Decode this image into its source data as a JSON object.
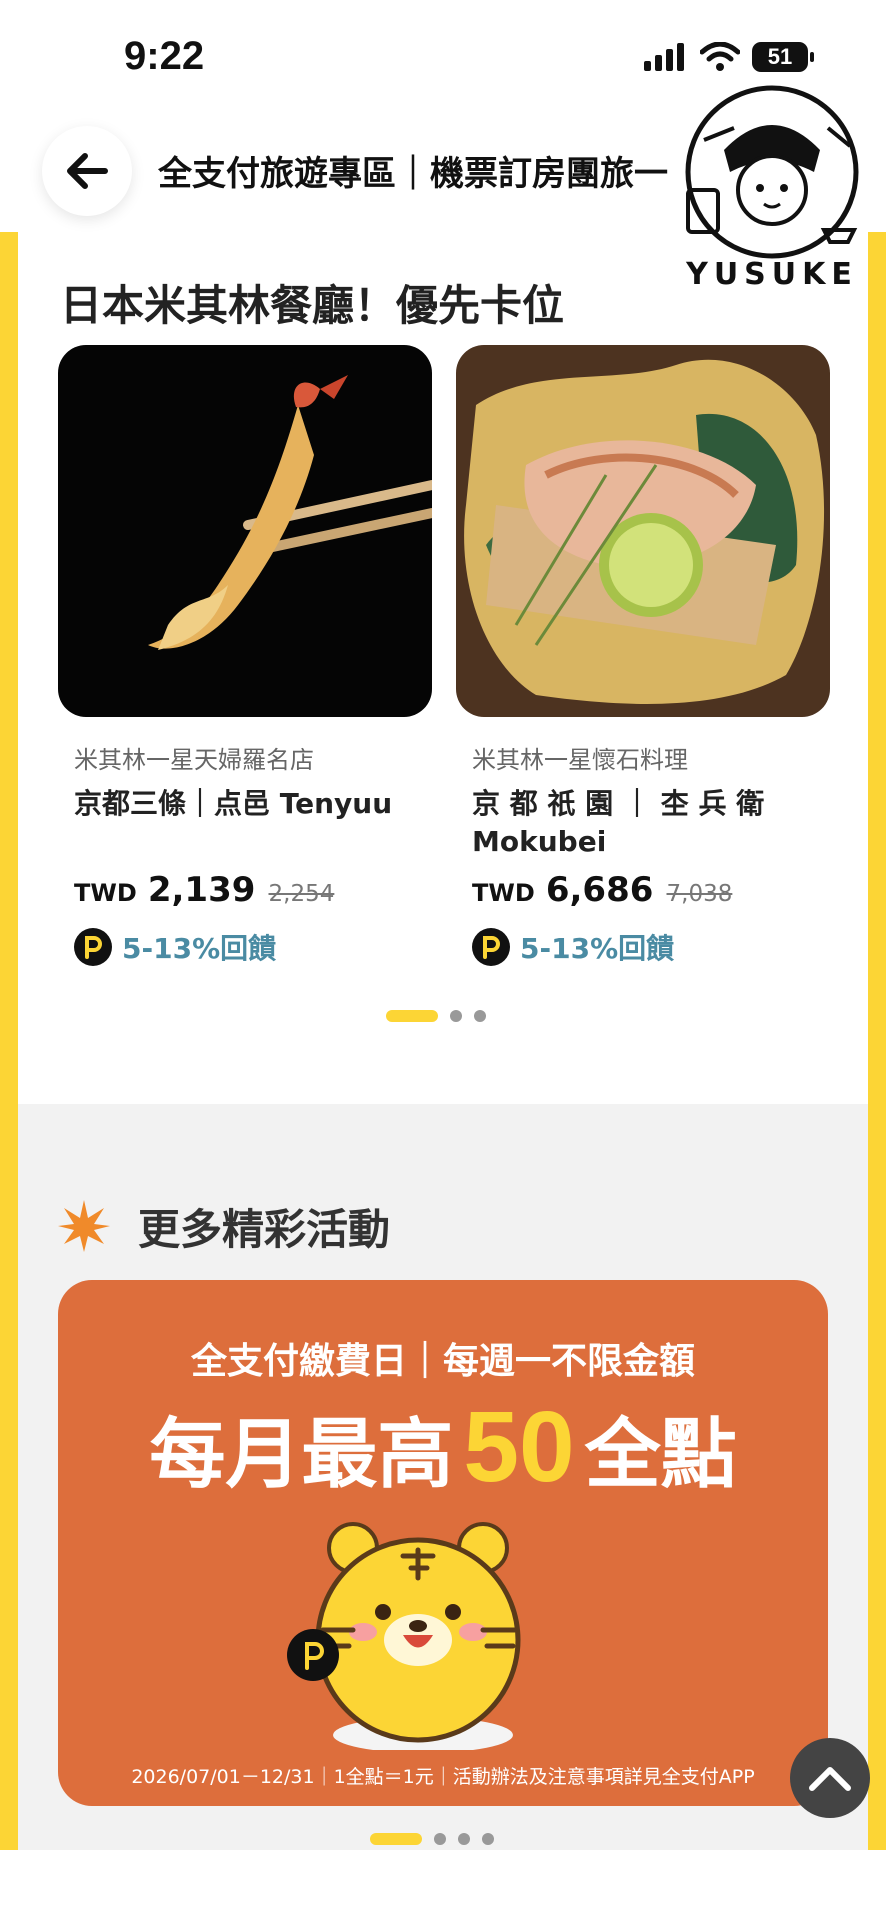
{
  "status": {
    "time": "9:22",
    "battery": "51"
  },
  "header": {
    "title": "全支付旅遊專區｜機票訂房團旅一"
  },
  "section": {
    "title": "日本米其林餐廳！優先卡位"
  },
  "cards": [
    {
      "subtitle": "米其林一星天婦羅名店",
      "name": "京都三條｜点邑 Tenyuu",
      "currency": "TWD",
      "price": "2,139",
      "original_price": "2,254",
      "reward": "5-13%回饋"
    },
    {
      "subtitle": "米其林一星懷石料理",
      "name": "京 都 祇 園 ｜ 杢 兵 衛 Mokubei",
      "currency": "TWD",
      "price": "6,686",
      "original_price": "7,038",
      "reward": "5-13%回饋"
    }
  ],
  "more": {
    "title": "更多精彩活動",
    "banner": {
      "line1": "全支付繳費日｜每週一不限金額",
      "line2_prefix": "每月最高",
      "line2_number": "50",
      "line2_suffix": "全點",
      "footer": "2026/07/01－12/31｜1全點＝1元｜活動辦法及注意事項詳見全支付APP"
    }
  },
  "watermark": {
    "text": "YUSUKE"
  },
  "colors": {
    "accent": "#fcd535",
    "banner": "#dd6e3c",
    "reward": "#4a8ba3"
  },
  "icons": {
    "back": "arrow-left-icon",
    "scroll_top": "chevron-up-icon",
    "reward": "p-point-icon",
    "sparkle": "star-burst-icon"
  }
}
